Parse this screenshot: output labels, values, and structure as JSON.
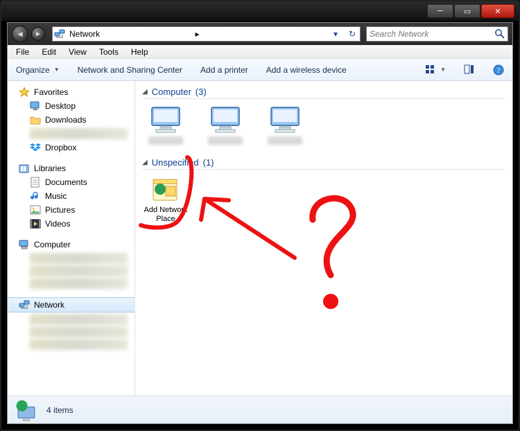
{
  "window": {
    "title": "",
    "min_tip": "Minimize",
    "max_tip": "Maximize",
    "close_tip": "Close"
  },
  "addressbar": {
    "path_display": "Network",
    "arrow1": "▸",
    "dropdown_glyph": "▾",
    "refresh_glyph": "↻"
  },
  "search": {
    "placeholder": "Search Network",
    "value": ""
  },
  "menubar": {
    "file": "File",
    "edit": "Edit",
    "view": "View",
    "tools": "Tools",
    "help": "Help"
  },
  "toolbar": {
    "organize": "Organize",
    "net_sharing": "Network and Sharing Center",
    "add_printer": "Add a printer",
    "add_wireless": "Add a wireless device",
    "view_tip": "Change your view",
    "preview_tip": "Show the preview pane",
    "help_tip": "Get help"
  },
  "sidebar": {
    "favorites": "Favorites",
    "desktop": "Desktop",
    "downloads": "Downloads",
    "dropbox": "Dropbox",
    "libraries": "Libraries",
    "documents": "Documents",
    "music": "Music",
    "pictures": "Pictures",
    "videos": "Videos",
    "computer": "Computer",
    "network": "Network"
  },
  "content": {
    "group1": {
      "label": "Computer",
      "count": "(3)"
    },
    "group2": {
      "label": "Unspecified",
      "count": "(1)"
    },
    "add_net_place": "Add Network Place"
  },
  "statusbar": {
    "items": "4 items"
  }
}
